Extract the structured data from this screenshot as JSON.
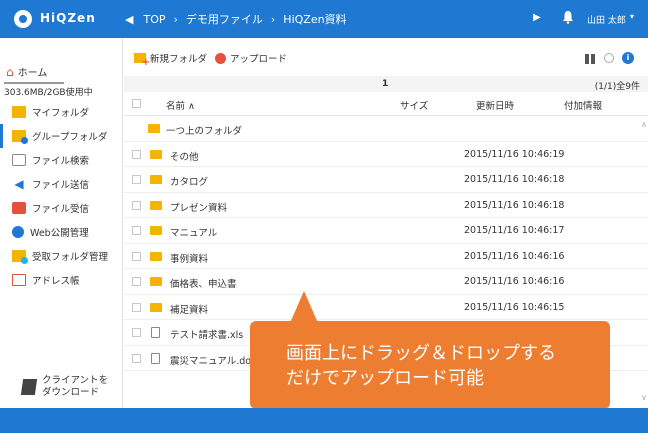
{
  "app": {
    "name": "HiQZen"
  },
  "breadcrumb": {
    "items": [
      "TOP",
      "デモ用ファイル",
      "HiQZen資料"
    ]
  },
  "header": {
    "user_name": "山田 太郎"
  },
  "sidebar": {
    "home_label": "ホーム",
    "quota_text": "303.6MB/2GB使用中",
    "items": [
      {
        "label": "マイフォルダ",
        "icon": "my-folder-icon"
      },
      {
        "label": "グループフォルダ",
        "icon": "group-folder-icon"
      },
      {
        "label": "ファイル検索",
        "icon": "file-search-icon"
      },
      {
        "label": "ファイル送信",
        "icon": "send-icon"
      },
      {
        "label": "ファイル受信",
        "icon": "receive-icon"
      },
      {
        "label": "Web公開管理",
        "icon": "web-icon"
      },
      {
        "label": "受取フォルダ管理",
        "icon": "inbox-folder-icon"
      },
      {
        "label": "アドレス帳",
        "icon": "address-book-icon"
      }
    ],
    "client_download": {
      "line1": "クライアントを",
      "line2": "ダウンロード"
    }
  },
  "toolbar": {
    "new_folder": "新規フォルダ",
    "upload": "アップロード"
  },
  "pager": {
    "page": "1",
    "count": "(1/1)全9件"
  },
  "table": {
    "headers": {
      "name": "名前 ∧",
      "size": "サイズ",
      "updated": "更新日時",
      "info": "付加情報"
    },
    "parent_row": "一つ上のフォルダ",
    "rows": [
      {
        "name": "その他",
        "updated": "2015/11/16 10:46:19",
        "type": "folder"
      },
      {
        "name": "カタログ",
        "updated": "2015/11/16 10:46:18",
        "type": "folder"
      },
      {
        "name": "プレゼン資料",
        "updated": "2015/11/16 10:46:18",
        "type": "folder"
      },
      {
        "name": "マニュアル",
        "updated": "2015/11/16 10:46:17",
        "type": "folder"
      },
      {
        "name": "事例資料",
        "updated": "2015/11/16 10:46:16",
        "type": "folder"
      },
      {
        "name": "価格表、申込書",
        "updated": "2015/11/16 10:46:16",
        "type": "folder"
      },
      {
        "name": "補足資料",
        "updated": "2015/11/16 10:46:15",
        "type": "folder"
      },
      {
        "name": "テスト請求書.xls",
        "updated": "",
        "type": "file"
      },
      {
        "name": "震災マニュアル.doc",
        "updated": "",
        "type": "file"
      }
    ]
  },
  "callout": {
    "text": "画面上にドラッグ＆ドロップする\nだけでアップロード可能"
  },
  "colors": {
    "primary": "#1f78d1",
    "accent": "#ed7d31",
    "folder": "#f4b400"
  }
}
